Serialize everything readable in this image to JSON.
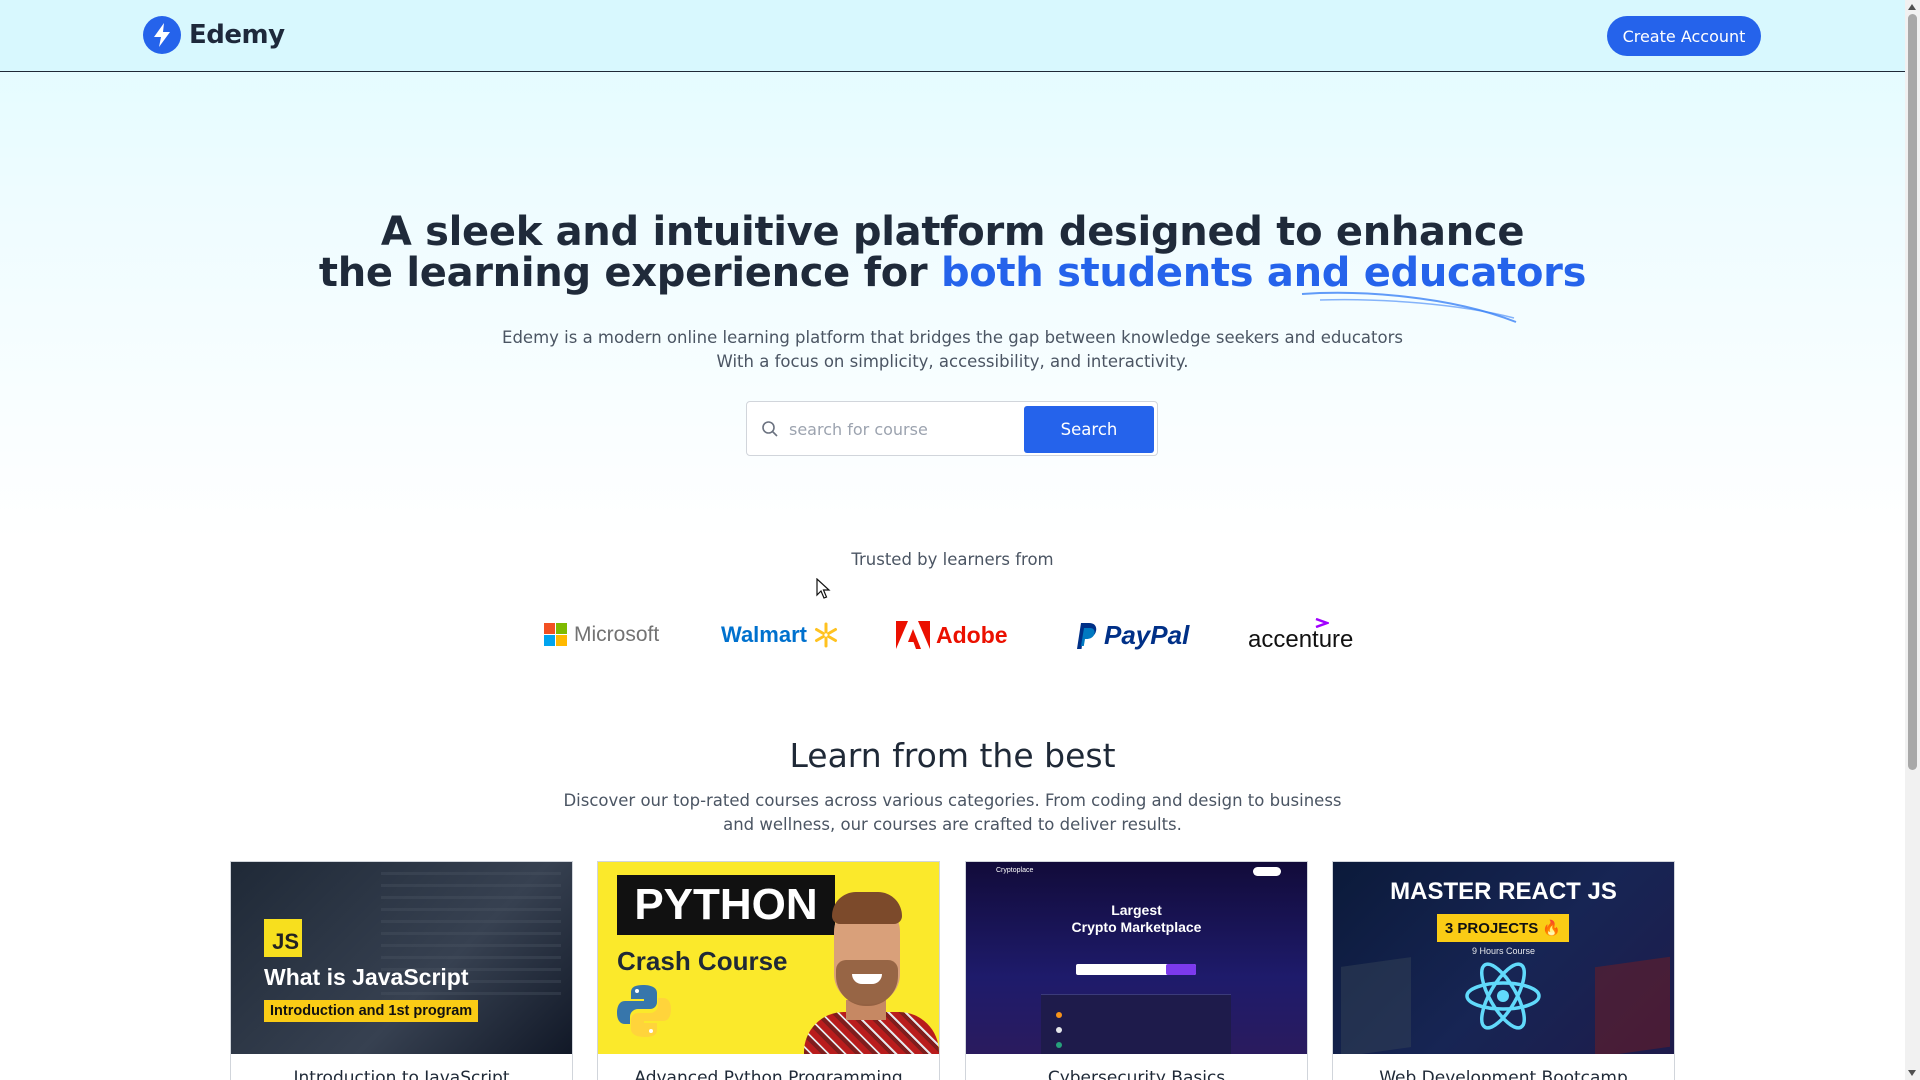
{
  "header": {
    "logo_text": "Edemy",
    "create_account_label": "Create Account"
  },
  "hero": {
    "title_line1": "A sleek and intuitive platform designed to enhance",
    "title_line2_prefix": "the learning experience for ",
    "title_line2_accent": "both students and educators",
    "subtitle_line1": "Edemy is a modern online learning platform that bridges the gap between knowledge seekers and educators",
    "subtitle_line2": "With a focus on simplicity, accessibility, and interactivity."
  },
  "search": {
    "placeholder": "search for course",
    "button_label": "Search"
  },
  "trusted": {
    "label": "Trusted by learners from",
    "brands": [
      "Microsoft",
      "Walmart",
      "Adobe",
      "PayPal",
      "accenture"
    ]
  },
  "courses_section": {
    "title": "Learn from the best",
    "subtitle_line1": "Discover our top-rated courses across various categories. From coding and design to business",
    "subtitle_line2": "and wellness, our courses are crafted to deliver results."
  },
  "courses": [
    {
      "title": "Introduction to JavaScript",
      "thumb_badge": "JS",
      "thumb_heading": "What is JavaScript",
      "thumb_tag": "Introduction and 1st program"
    },
    {
      "title": "Advanced Python Programming",
      "thumb_heading": "PYTHON",
      "thumb_sub": "Crash Course"
    },
    {
      "title": "Cybersecurity Basics",
      "thumb_brand": "Cryptoplace",
      "thumb_heading_line1": "Largest",
      "thumb_heading_line2": "Crypto Marketplace"
    },
    {
      "title": "Web Development Bootcamp",
      "thumb_heading": "MASTER REACT JS",
      "thumb_tag": "3 PROJECTS 🔥",
      "thumb_sub": "9 Hours Course"
    }
  ],
  "colors": {
    "accent": "#2563eb",
    "header_bg": "#d8f8fe",
    "text_dark": "#1f2a3a"
  }
}
